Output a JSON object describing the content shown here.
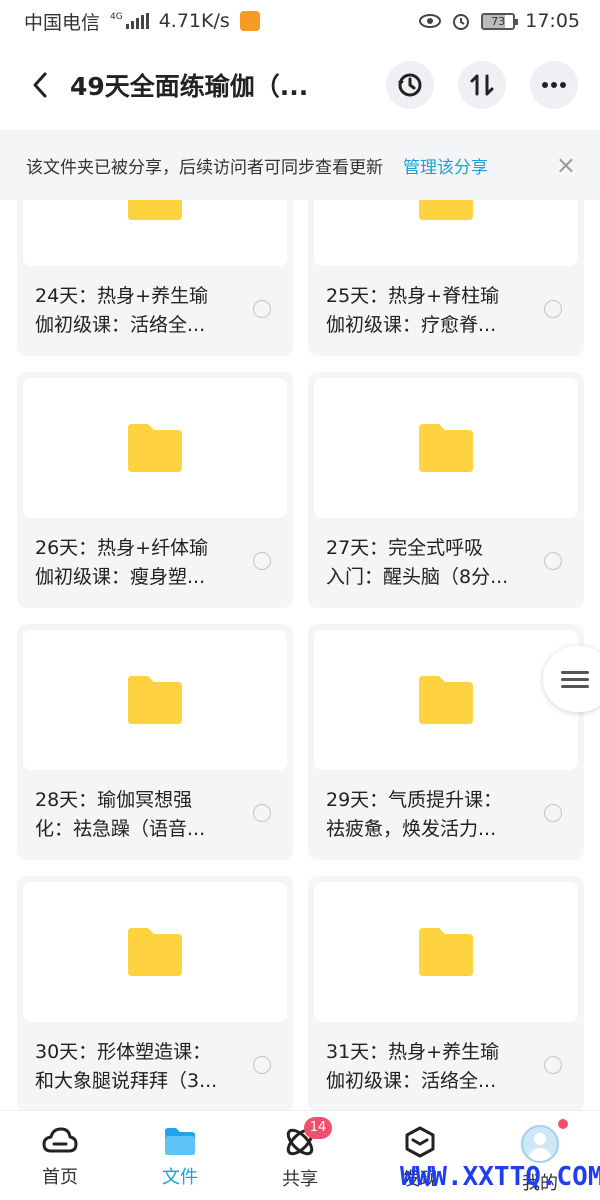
{
  "status_bar": {
    "carrier": "中国电信",
    "network": "4G",
    "speed": "4.71K/s",
    "battery": "73",
    "time": "17:05"
  },
  "header": {
    "title": "49天全面练瑜伽（...",
    "back_icon": "back-arrow-icon",
    "actions": [
      "history-icon",
      "transfer-icon",
      "more-icon"
    ]
  },
  "banner": {
    "text": "该文件夹已被分享，后续访问者可同步查看更新",
    "link": "管理该分享",
    "close": "×"
  },
  "folders": [
    {
      "line1": "24天：热身+养生瑜",
      "line2": "伽初级课：活络全..."
    },
    {
      "line1": "25天：热身+脊柱瑜",
      "line2": "伽初级课：疗愈脊..."
    },
    {
      "line1": "26天：热身+纤体瑜",
      "line2": "伽初级课：瘦身塑..."
    },
    {
      "line1": "27天：完全式呼吸",
      "line2": "入门：醒头脑（8分..."
    },
    {
      "line1": "28天：瑜伽冥想强",
      "line2": "化：祛急躁（语音..."
    },
    {
      "line1": "29天：气质提升课：",
      "line2": "祛疲惫，焕发活力..."
    },
    {
      "line1": "30天：形体塑造课：",
      "line2": "和大象腿说拜拜（3..."
    },
    {
      "line1": "31天：热身+养生瑜",
      "line2": "伽初级课：活络全..."
    }
  ],
  "nav": {
    "items": [
      {
        "label": "首页",
        "icon": "cloud-icon"
      },
      {
        "label": "文件",
        "icon": "folder-icon"
      },
      {
        "label": "共享",
        "icon": "share-atom-icon",
        "badge": "14"
      },
      {
        "label": "发现",
        "icon": "discover-box-icon"
      },
      {
        "label": "我的",
        "icon": "avatar-icon"
      }
    ]
  },
  "watermark": "WWW.XXTTQ.COM",
  "colors": {
    "accent": "#1e9fd8",
    "folder": "#ffd23f",
    "badge": "#f0506e",
    "card_bg": "#f4f5f7"
  }
}
